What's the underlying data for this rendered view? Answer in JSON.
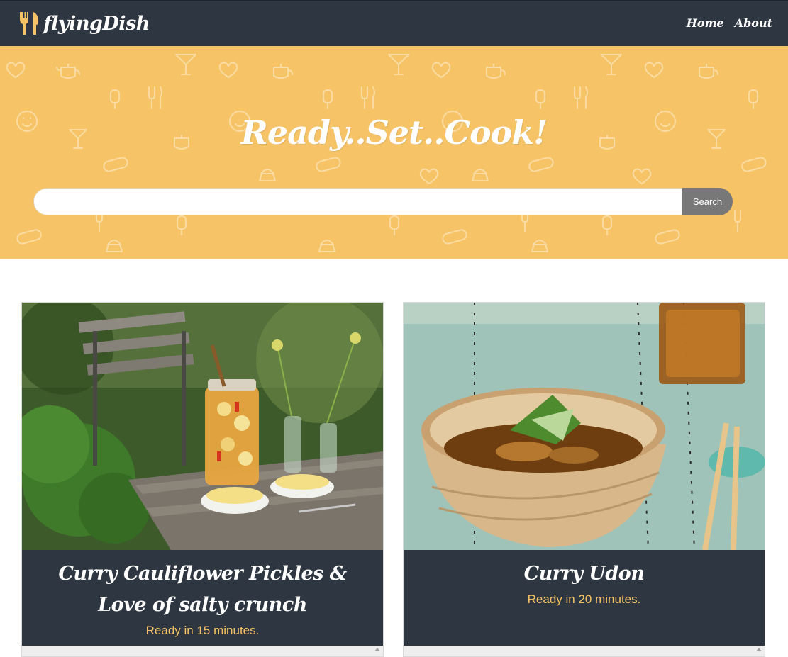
{
  "navbar": {
    "brand": "flyingDish",
    "brand_icon": "fork-spoon-icon",
    "links": [
      "Home",
      "About"
    ]
  },
  "hero": {
    "title": "Ready..Set..Cook!",
    "search": {
      "value": "",
      "placeholder": "",
      "button": "Search"
    },
    "background_color": "#f6c367",
    "pattern_icons": [
      "heart-icon",
      "teapot-icon",
      "cocktail-icon",
      "fork-knife-icon",
      "popsicle-icon",
      "smiley-icon",
      "hotdog-icon",
      "cupcake-icon"
    ]
  },
  "recipes": [
    {
      "title": "Curry Cauliflower Pickles & Love of salty crunch",
      "time": "Ready in 15 minutes.",
      "image": "pickle-jar-photo"
    },
    {
      "title": "Curry Udon",
      "time": "Ready in 20 minutes.",
      "image": "udon-bowl-photo"
    }
  ],
  "colors": {
    "nav": "#2e3641",
    "accent": "#f6c367",
    "button": "#787878"
  }
}
